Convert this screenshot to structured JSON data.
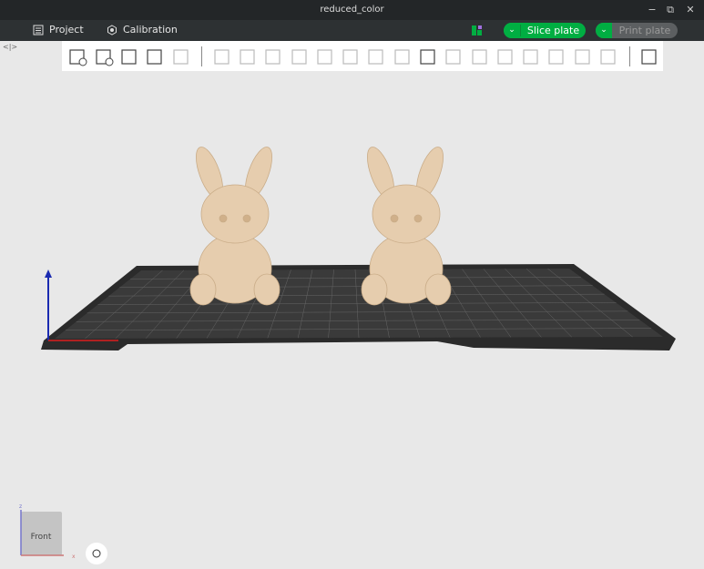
{
  "window": {
    "title": "reduced_color",
    "minimize": "−",
    "restore": "⧉",
    "close": "✕"
  },
  "menubar": {
    "project": "Project",
    "calibration": "Calibration",
    "slice": "Slice plate",
    "print": "Print plate"
  },
  "toolbar": {
    "groups": [
      [
        "add-object",
        "add-plate",
        "auto-orient",
        "arrange",
        "layers"
      ],
      [
        "move",
        "rotate",
        "scale",
        "lay-on-face",
        "cut",
        "boolean",
        "support-paint",
        "color-paint",
        "text",
        "emboss",
        "assembly",
        "fix-model",
        "variable-layer",
        "measure-o",
        "measure-p",
        "ruler"
      ],
      [
        "split-parts"
      ]
    ]
  },
  "viewport": {
    "axis_z": "z",
    "axis_x": "x",
    "view_cube": "Front"
  },
  "colors": {
    "accent": "#00ae42",
    "bunny": "#e6cdae",
    "plate": "#2a2a2a"
  }
}
